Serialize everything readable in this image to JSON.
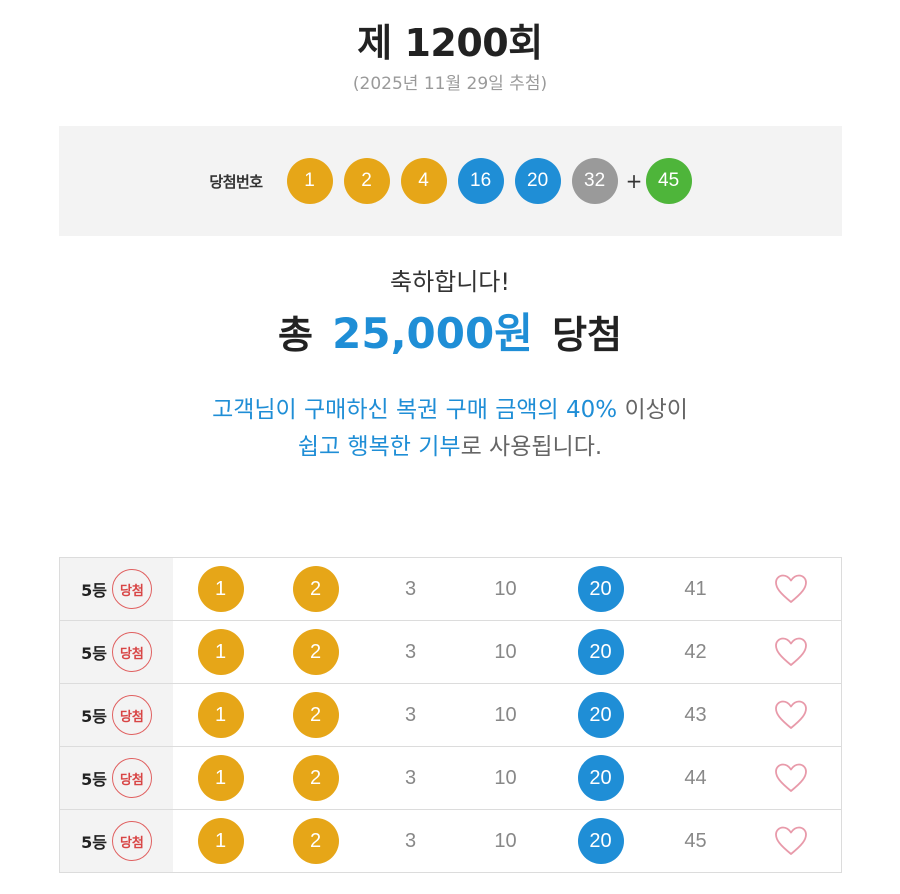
{
  "header": {
    "round_title": "제 1200회",
    "draw_date": "(2025년 11월 29일 추첨)"
  },
  "winning": {
    "label": "당첨번호",
    "numbers": [
      {
        "value": "1",
        "color": "#e6a618"
      },
      {
        "value": "2",
        "color": "#e6a618"
      },
      {
        "value": "4",
        "color": "#e6a618"
      },
      {
        "value": "16",
        "color": "#1f8ed6"
      },
      {
        "value": "20",
        "color": "#1f8ed6"
      },
      {
        "value": "32",
        "color": "#9a9a9a"
      }
    ],
    "plus": "+",
    "bonus": {
      "value": "45",
      "color": "#4eb53a"
    }
  },
  "result": {
    "congrats": "축하합니다!",
    "total_prefix": "총",
    "total_amount": "25,000원",
    "total_suffix": "당첨"
  },
  "donation": {
    "line1_blue": "고객님이 구매하신 복권 구매 금액의 40%",
    "line1_gray": " 이상이",
    "line2_blue": "쉽고 행복한 기부",
    "line2_gray": "로 사용됩니다."
  },
  "colors": {
    "accent_blue": "#1f8ed6",
    "ball_yellow": "#e6a618",
    "ball_gray": "#9a9a9a",
    "ball_green": "#4eb53a",
    "badge_red": "#d84545",
    "heart_pink": "#e89aaa"
  },
  "tickets": [
    {
      "rank": "5등",
      "badge": "당첨",
      "numbers": [
        {
          "value": "1",
          "matched": true,
          "color": "#e6a618"
        },
        {
          "value": "2",
          "matched": true,
          "color": "#e6a618"
        },
        {
          "value": "3",
          "matched": false
        },
        {
          "value": "10",
          "matched": false
        },
        {
          "value": "20",
          "matched": true,
          "color": "#1f8ed6"
        },
        {
          "value": "41",
          "matched": false
        }
      ],
      "icon": "heart-icon"
    },
    {
      "rank": "5등",
      "badge": "당첨",
      "numbers": [
        {
          "value": "1",
          "matched": true,
          "color": "#e6a618"
        },
        {
          "value": "2",
          "matched": true,
          "color": "#e6a618"
        },
        {
          "value": "3",
          "matched": false
        },
        {
          "value": "10",
          "matched": false
        },
        {
          "value": "20",
          "matched": true,
          "color": "#1f8ed6"
        },
        {
          "value": "42",
          "matched": false
        }
      ],
      "icon": "heart-icon"
    },
    {
      "rank": "5등",
      "badge": "당첨",
      "numbers": [
        {
          "value": "1",
          "matched": true,
          "color": "#e6a618"
        },
        {
          "value": "2",
          "matched": true,
          "color": "#e6a618"
        },
        {
          "value": "3",
          "matched": false
        },
        {
          "value": "10",
          "matched": false
        },
        {
          "value": "20",
          "matched": true,
          "color": "#1f8ed6"
        },
        {
          "value": "43",
          "matched": false
        }
      ],
      "icon": "heart-icon"
    },
    {
      "rank": "5등",
      "badge": "당첨",
      "numbers": [
        {
          "value": "1",
          "matched": true,
          "color": "#e6a618"
        },
        {
          "value": "2",
          "matched": true,
          "color": "#e6a618"
        },
        {
          "value": "3",
          "matched": false
        },
        {
          "value": "10",
          "matched": false
        },
        {
          "value": "20",
          "matched": true,
          "color": "#1f8ed6"
        },
        {
          "value": "44",
          "matched": false
        }
      ],
      "icon": "heart-icon"
    },
    {
      "rank": "5등",
      "badge": "당첨",
      "numbers": [
        {
          "value": "1",
          "matched": true,
          "color": "#e6a618"
        },
        {
          "value": "2",
          "matched": true,
          "color": "#e6a618"
        },
        {
          "value": "3",
          "matched": false
        },
        {
          "value": "10",
          "matched": false
        },
        {
          "value": "20",
          "matched": true,
          "color": "#1f8ed6"
        },
        {
          "value": "45",
          "matched": false
        }
      ],
      "icon": "heart-icon"
    }
  ]
}
